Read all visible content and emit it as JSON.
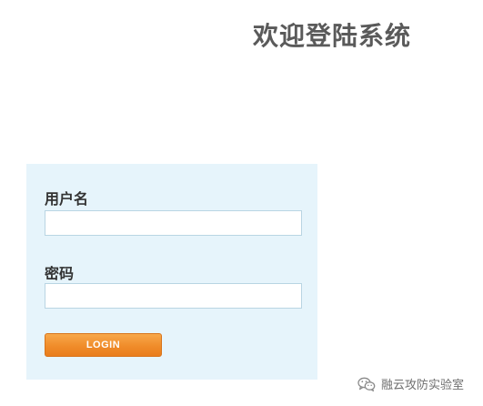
{
  "page": {
    "title": "欢迎登陆系统"
  },
  "login_form": {
    "username_label": "用户名",
    "username_value": "",
    "password_label": "密码",
    "password_value": "",
    "login_button_label": "LOGIN"
  },
  "watermark": {
    "text": "融云攻防实验室",
    "icon": "wechat-icon"
  },
  "colors": {
    "title": "#5a5a5a",
    "panel_background": "#e6f4fb",
    "field_border": "#b9d5e3",
    "button_orange": "#f08c2a",
    "button_text": "#ffffff"
  }
}
